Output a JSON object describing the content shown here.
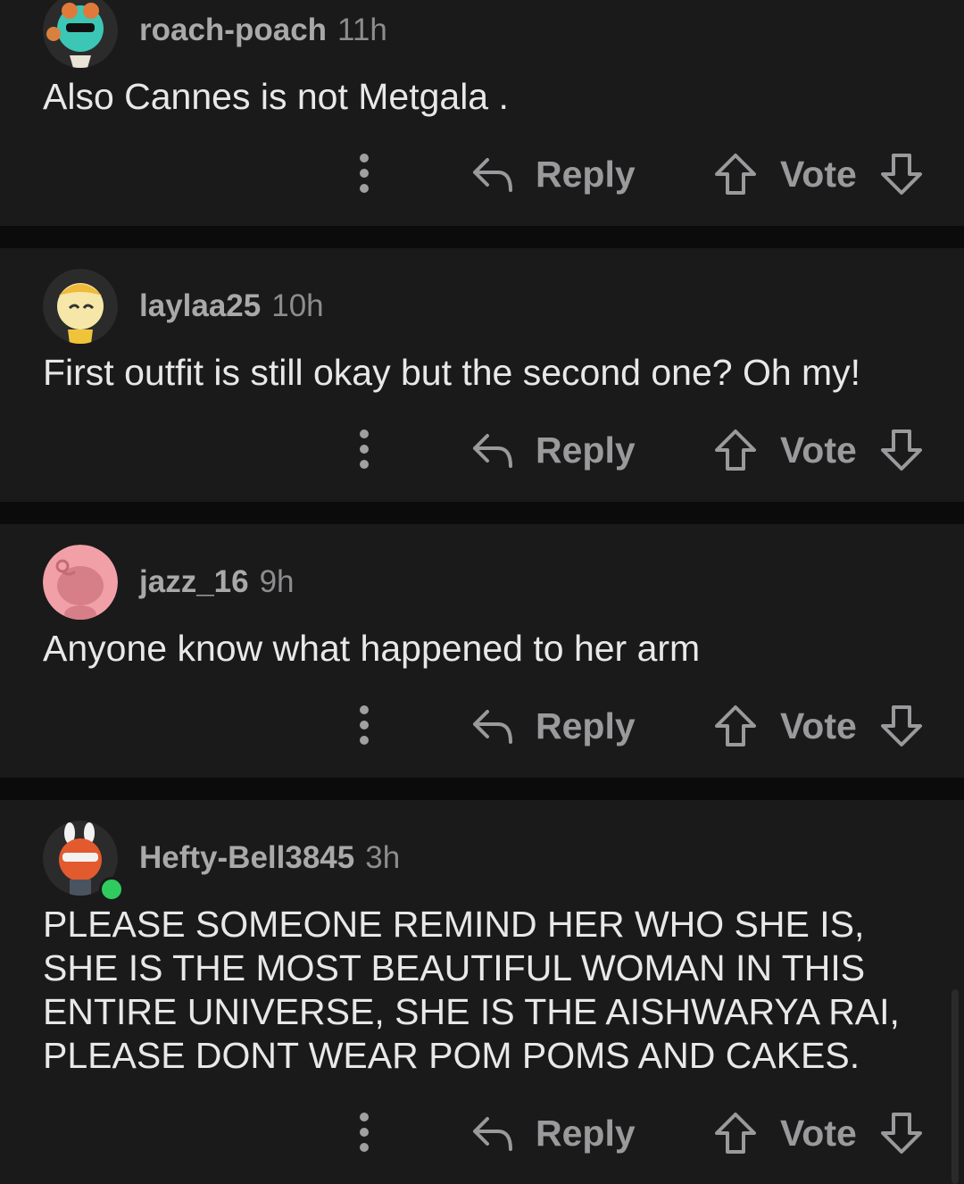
{
  "comments": [
    {
      "username": "roach-poach",
      "time": "11h",
      "text": "Also Cannes is not Metgala .",
      "avatar": "avatar-teal-cat",
      "reply_label": "Reply",
      "vote_label": "Vote"
    },
    {
      "username": "laylaa25",
      "time": "10h",
      "text": "First outfit is still okay but the second one? Oh my!",
      "avatar": "avatar-yellow-tiger",
      "reply_label": "Reply",
      "vote_label": "Vote"
    },
    {
      "username": "jazz_16",
      "time": "9h",
      "text": "Anyone know what happened to her arm",
      "avatar": "avatar-pink-snoo",
      "reply_label": "Reply",
      "vote_label": "Vote"
    },
    {
      "username": "Hefty-Bell3845",
      "time": "3h",
      "text": "PLEASE SOMEONE REMIND HER WHO SHE IS, SHE IS THE MOST BEAUTIFUL WOMAN IN THIS ENTIRE UNIVERSE, SHE IS THE AISHWARYA RAI, PLEASE DONT WEAR POM POMS AND CAKES.",
      "avatar": "avatar-bunny-hat",
      "online": true,
      "reply_label": "Reply",
      "vote_label": "Vote"
    }
  ],
  "colors": {
    "background": "#0b0b0b",
    "card": "#1a1a1b",
    "online": "#2fcb5f"
  }
}
